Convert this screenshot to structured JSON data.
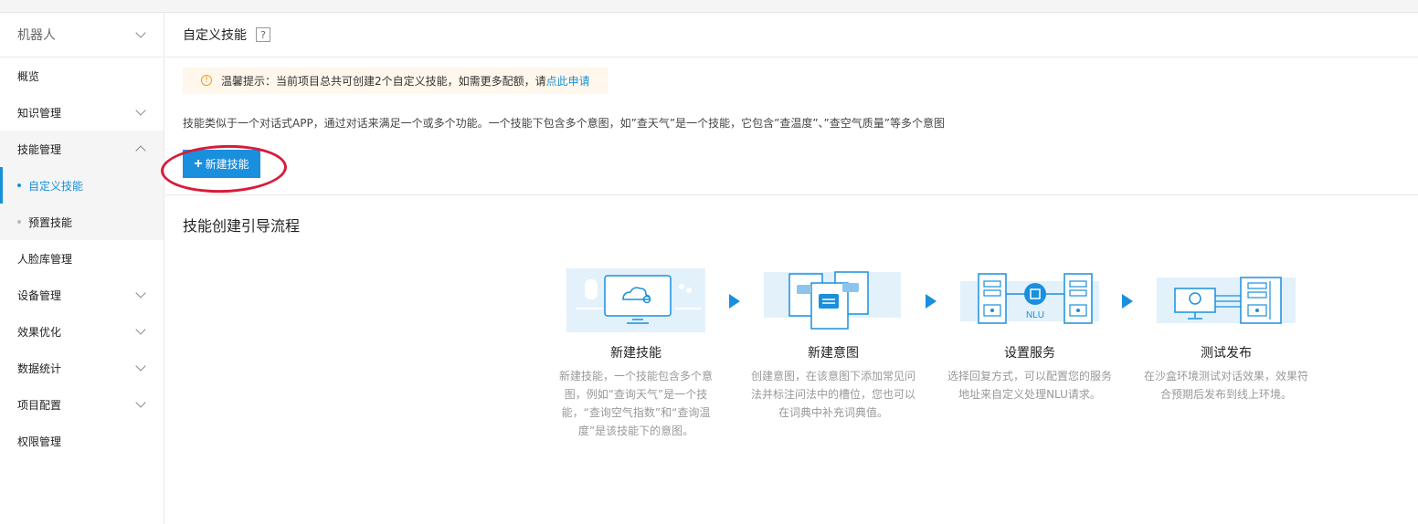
{
  "sidebar": {
    "title": "机器人",
    "items": [
      {
        "label": "概览"
      },
      {
        "label": "知识管理"
      },
      {
        "label": "技能管理"
      },
      {
        "label": "人脸库管理"
      },
      {
        "label": "设备管理"
      },
      {
        "label": "效果优化"
      },
      {
        "label": "数据统计"
      },
      {
        "label": "项目配置"
      },
      {
        "label": "权限管理"
      }
    ],
    "sub_items": [
      {
        "label": "自定义技能"
      },
      {
        "label": "预置技能"
      }
    ]
  },
  "main": {
    "title": "自定义技能",
    "help": "?",
    "tip": {
      "icon": "info-icon",
      "prefix": "温馨提示：当前项目总共可创建2个自定义技能，如需更多配额，请",
      "link": "点此申请"
    },
    "description": "技能类似于一个对话式APP，通过对话来满足一个或多个功能。一个技能下包含多个意图，如”查天气”是一个技能，它包含”查温度”、”查空气质量”等多个意图",
    "new_button": "新建技能",
    "flow_title": "技能创建引导流程"
  },
  "steps": [
    {
      "title": "新建技能",
      "desc": "新建技能，一个技能包含多个意图，例如“查询天气”是一个技能，“查询空气指数”和“查询温度”是该技能下的意图。"
    },
    {
      "title": "新建意图",
      "desc": "创建意图，在该意图下添加常见问法并标注问法中的槽位，您也可以在词典中补充词典值。"
    },
    {
      "title": "设置服务",
      "desc": "选择回复方式，可以配置您的服务地址来自定义处理NLU请求。",
      "art_label": "NLU"
    },
    {
      "title": "测试发布",
      "desc": "在沙盒环境测试对话效果，效果符合预期后发布到线上环境。"
    }
  ],
  "colors": {
    "accent": "#1a8fdd",
    "annotation": "#d81b3a",
    "tip_bg": "#fff7ec"
  }
}
